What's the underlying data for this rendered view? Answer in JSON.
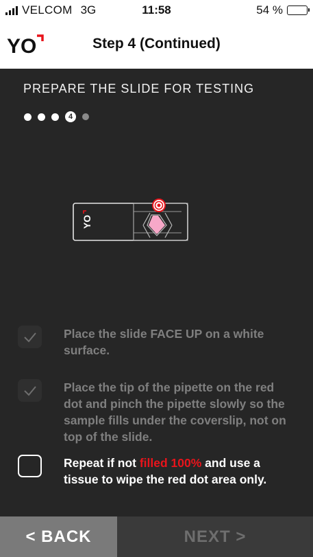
{
  "status_bar": {
    "carrier": "VELCOM",
    "network": "3G",
    "time": "11:58",
    "battery_percent": "54 %",
    "battery_level": 0.54
  },
  "header": {
    "logo_text": "YO",
    "title": "Step 4 (Continued)"
  },
  "section_title": "PREPARE THE SLIDE FOR TESTING",
  "progress": {
    "total_steps": 5,
    "current_step": "4"
  },
  "slide": {
    "logo_text": "YO"
  },
  "checklist": [
    {
      "checked": true,
      "text": "Place the slide FACE UP on a white surface."
    },
    {
      "checked": true,
      "text": "Place the tip of the pipette on the red dot and pinch the pipette slowly so the sample fills under the coverslip, not on top of the slide."
    },
    {
      "checked": false,
      "text_before": "Repeat if not ",
      "highlight": "filled 100%",
      "text_after": " and use a tissue to wipe the red dot area only."
    }
  ],
  "footer": {
    "back_label": "< BACK",
    "next_label": "NEXT >"
  },
  "colors": {
    "background": "#262626",
    "accent_red": "#e8141b",
    "slide_pink": "#f7a8c8",
    "back_button": "#7a7a7a",
    "next_button_disabled": "#3a3a3a"
  }
}
